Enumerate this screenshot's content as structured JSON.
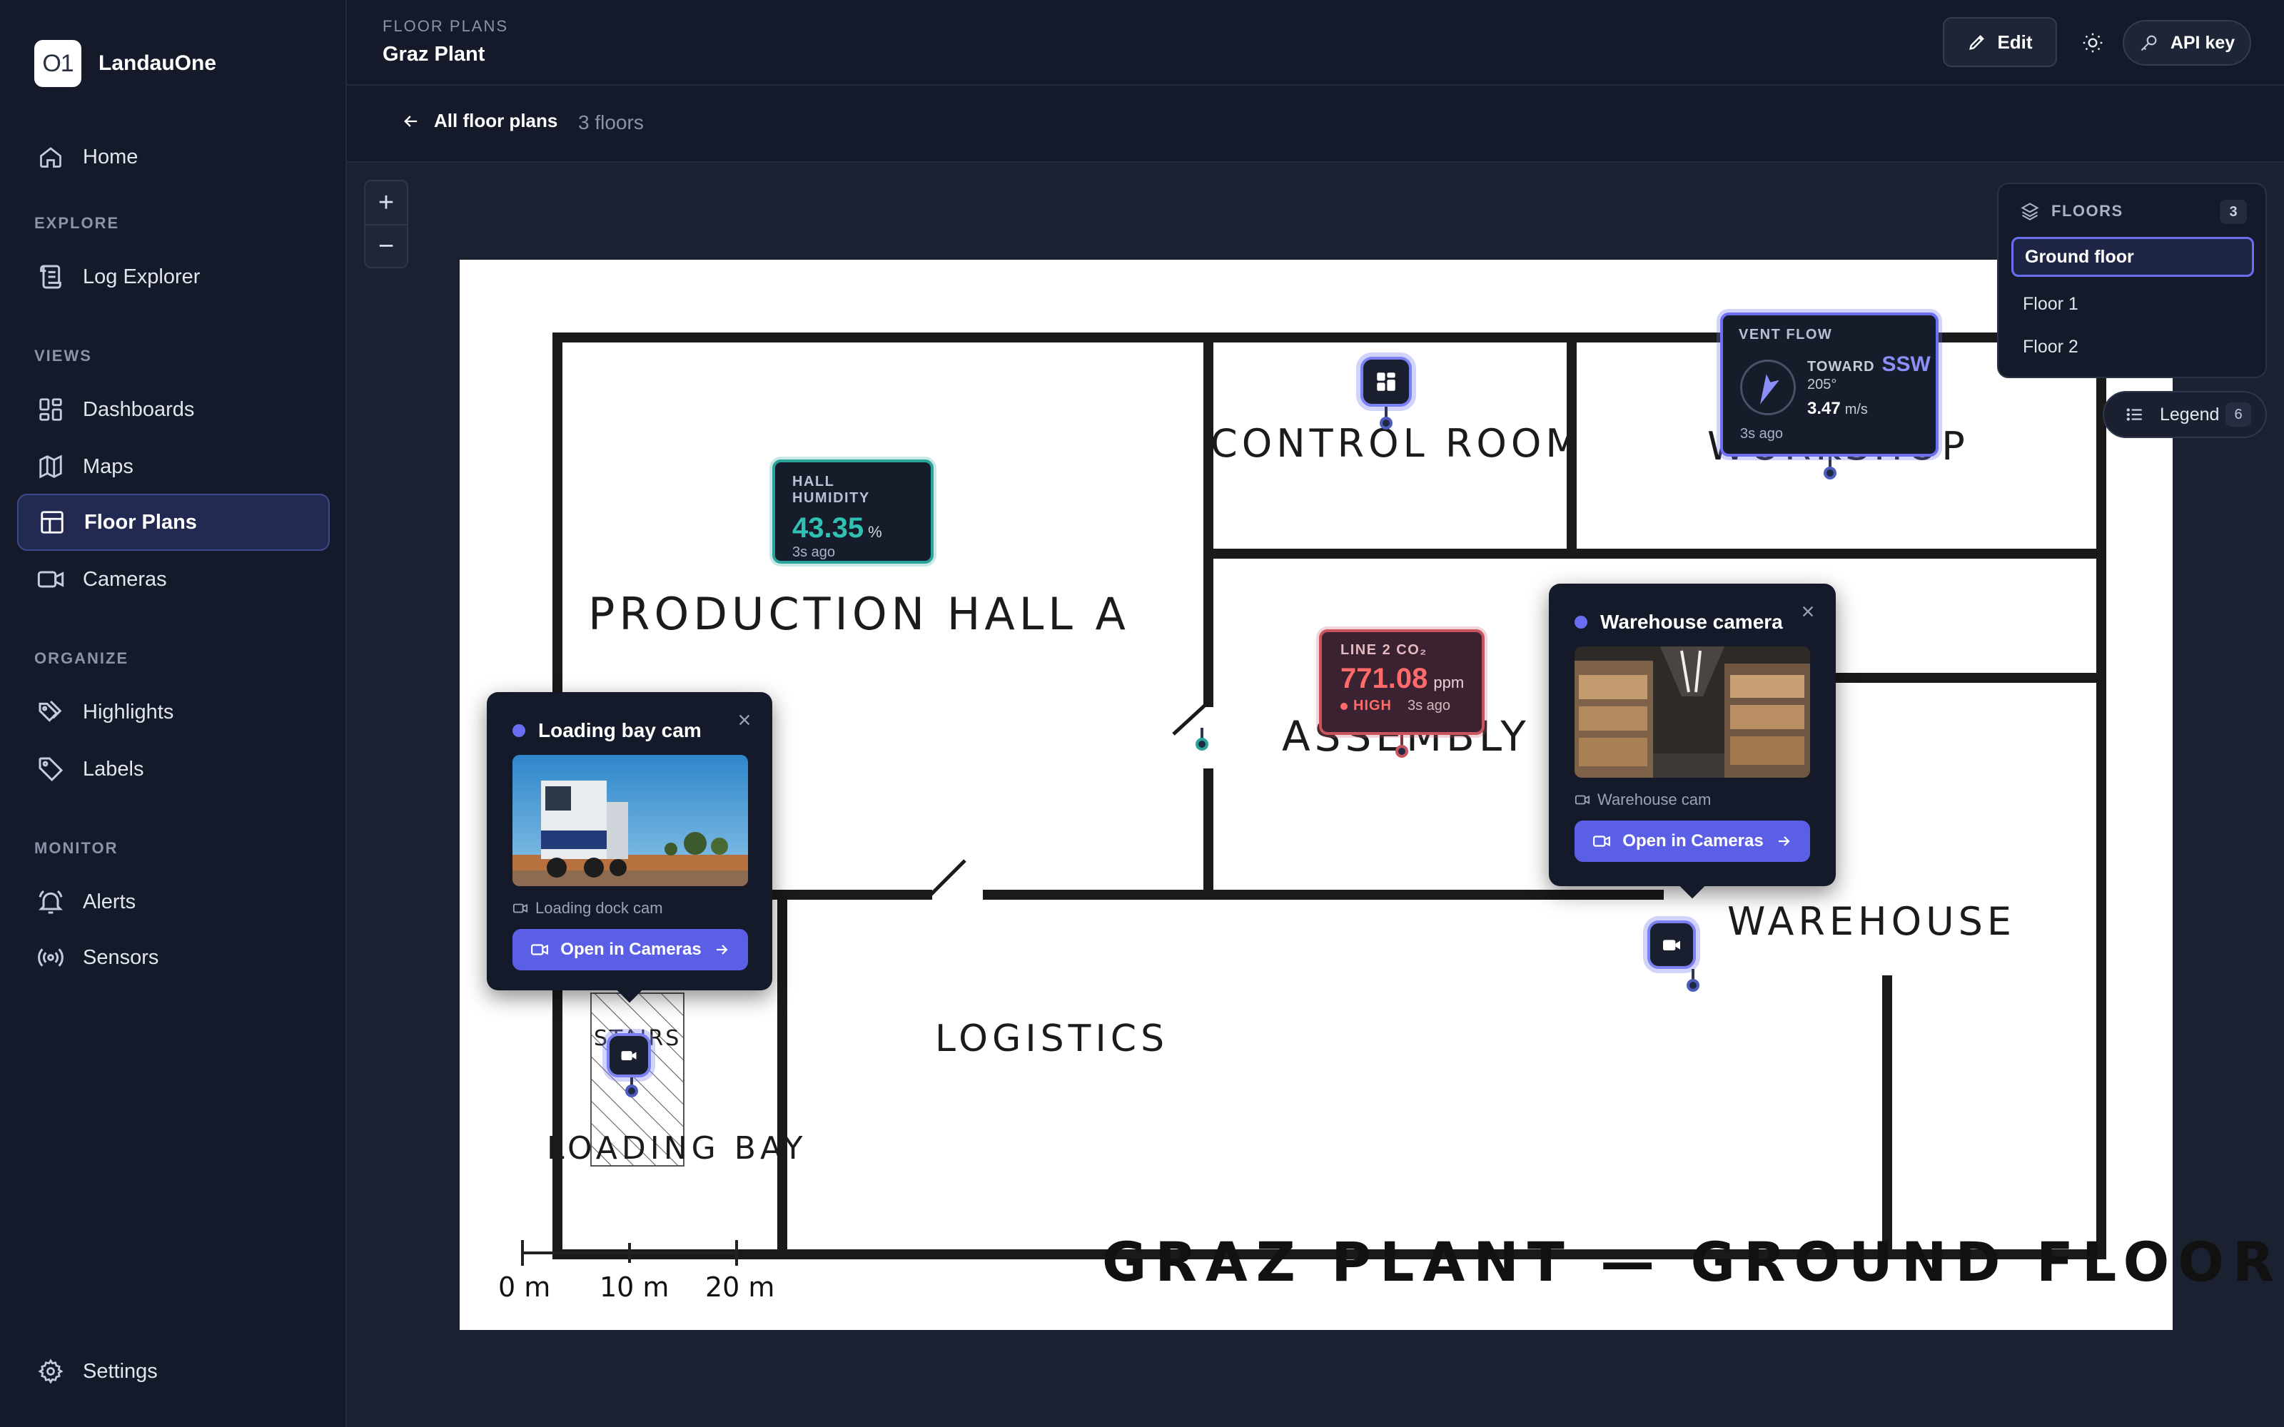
{
  "brand": {
    "logo_text": "O1",
    "name": "LandauOne"
  },
  "nav": {
    "home": "Home",
    "explore_section": "EXPLORE",
    "log_explorer": "Log Explorer",
    "views_section": "VIEWS",
    "dashboards": "Dashboards",
    "maps": "Maps",
    "floor_plans": "Floor Plans",
    "cameras": "Cameras",
    "organize_section": "ORGANIZE",
    "highlights": "Highlights",
    "labels": "Labels",
    "monitor_section": "MONITOR",
    "alerts": "Alerts",
    "sensors": "Sensors",
    "settings": "Settings",
    "active": "Floor Plans"
  },
  "header": {
    "section": "FLOOR PLANS",
    "title": "Graz Plant",
    "edit_label": "Edit",
    "api_label": "API key"
  },
  "subbar": {
    "back_label": "All floor plans",
    "floor_count": "3 floors"
  },
  "zoom": {
    "in": "+",
    "out": "−"
  },
  "plan": {
    "rooms": {
      "production": "PRODUCTION HALL A",
      "control": "CONTROL ROOM",
      "workshop": "WORKSHOP",
      "assembly": "ASSEMBLY",
      "warehouse": "WAREHOUSE",
      "logistics": "LOGISTICS",
      "stairs": "STAIRS",
      "loading": "LOADING BAY"
    },
    "title": "GRAZ PLANT — GROUND FLOOR",
    "scale": [
      "0 m",
      "10 m",
      "20 m"
    ]
  },
  "widgets": {
    "humidity": {
      "label": "HALL HUMIDITY",
      "value": "43.35",
      "unit": "%",
      "ago": "3s ago",
      "color": "#2fc1b3"
    },
    "co2": {
      "label": "LINE 2 CO₂",
      "value": "771.08",
      "unit": "ppm",
      "status": "HIGH",
      "ago": "3s ago",
      "color": "#ff6b6b"
    },
    "vent": {
      "label": "VENT FLOW",
      "toward": "TOWARD",
      "direction": "SSW",
      "degrees": "205°",
      "speed": "3.47",
      "speed_unit": "m/s",
      "ago": "3s ago",
      "heading_deg": 205
    }
  },
  "popovers": {
    "loading": {
      "title": "Loading bay cam",
      "source": "Loading dock cam",
      "button": "Open in Cameras"
    },
    "warehouse": {
      "title": "Warehouse camera",
      "source": "Warehouse cam",
      "button": "Open in Cameras"
    }
  },
  "floors_panel": {
    "header": "FLOORS",
    "count": "3",
    "options": [
      "Ground floor",
      "Floor 1",
      "Floor 2"
    ],
    "selected": "Ground floor"
  },
  "legend": {
    "label": "Legend",
    "count": "6"
  },
  "colors": {
    "accent": "#6b6ef2",
    "humidity": "#2aa39a",
    "alert": "#c9545e"
  }
}
